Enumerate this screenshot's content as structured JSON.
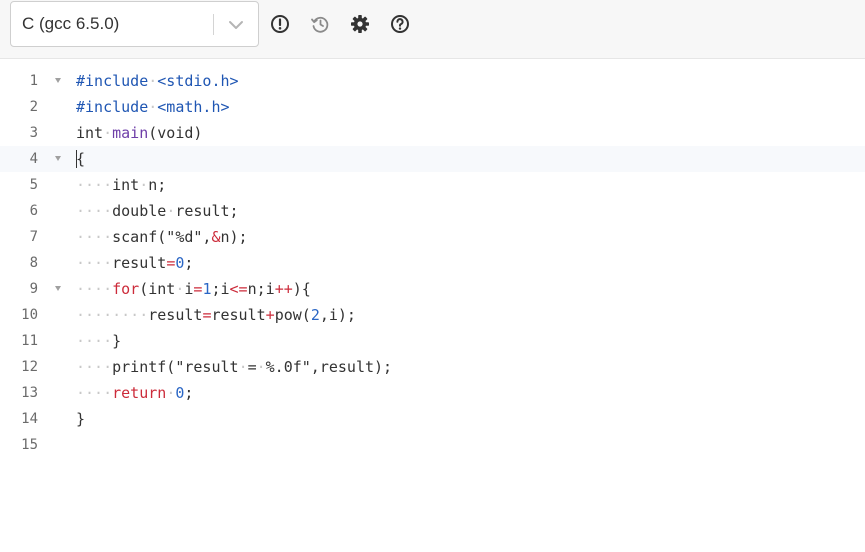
{
  "toolbar": {
    "language_value": "C (gcc 6.5.0)",
    "icons": [
      "info-icon",
      "history-icon",
      "gear-icon",
      "help-icon"
    ]
  },
  "editor": {
    "active_line": 4,
    "colors": {
      "default": "#333333",
      "preproc": "#1f56b3",
      "keyword": "#cc2b3a",
      "number": "#2a66c5",
      "string": "#333333",
      "func": "#6e3ea8",
      "whitespace_dot": "#c8c8c8",
      "line_number": "#6b6b6b"
    },
    "lines": [
      {
        "number": "1",
        "fold": true,
        "tokens": [
          {
            "t": "#include",
            "c": "preproc"
          },
          {
            "t": " ",
            "c": "ws"
          },
          {
            "t": "<stdio.h>",
            "c": "preproc"
          }
        ]
      },
      {
        "number": "2",
        "fold": false,
        "tokens": [
          {
            "t": "#include",
            "c": "preproc"
          },
          {
            "t": " ",
            "c": "ws"
          },
          {
            "t": "<math.h>",
            "c": "preproc"
          }
        ]
      },
      {
        "number": "3",
        "fold": false,
        "tokens": [
          {
            "t": "int",
            "c": "default"
          },
          {
            "t": " ",
            "c": "ws"
          },
          {
            "t": "main",
            "c": "func"
          },
          {
            "t": "(void)",
            "c": "default"
          }
        ]
      },
      {
        "number": "4",
        "fold": true,
        "tokens": [
          {
            "t": "{",
            "c": "default"
          }
        ]
      },
      {
        "number": "5",
        "fold": false,
        "tokens": [
          {
            "t": "    ",
            "c": "ws"
          },
          {
            "t": "int",
            "c": "default"
          },
          {
            "t": " ",
            "c": "ws"
          },
          {
            "t": "n;",
            "c": "default"
          }
        ]
      },
      {
        "number": "6",
        "fold": false,
        "tokens": [
          {
            "t": "    ",
            "c": "ws"
          },
          {
            "t": "double",
            "c": "default"
          },
          {
            "t": " ",
            "c": "ws"
          },
          {
            "t": "result;",
            "c": "default"
          }
        ]
      },
      {
        "number": "7",
        "fold": false,
        "tokens": [
          {
            "t": "    ",
            "c": "ws"
          },
          {
            "t": "scanf(\"%d\",",
            "c": "default"
          },
          {
            "t": "&",
            "c": "keyword"
          },
          {
            "t": "n);",
            "c": "default"
          }
        ]
      },
      {
        "number": "8",
        "fold": false,
        "tokens": [
          {
            "t": "    ",
            "c": "ws"
          },
          {
            "t": "result",
            "c": "default"
          },
          {
            "t": "=",
            "c": "keyword"
          },
          {
            "t": "0",
            "c": "number"
          },
          {
            "t": ";",
            "c": "default"
          }
        ]
      },
      {
        "number": "9",
        "fold": true,
        "tokens": [
          {
            "t": "    ",
            "c": "ws"
          },
          {
            "t": "for",
            "c": "keyword"
          },
          {
            "t": "(int",
            "c": "default"
          },
          {
            "t": " ",
            "c": "ws"
          },
          {
            "t": "i",
            "c": "default"
          },
          {
            "t": "=",
            "c": "keyword"
          },
          {
            "t": "1",
            "c": "number"
          },
          {
            "t": ";i",
            "c": "default"
          },
          {
            "t": "<=",
            "c": "keyword"
          },
          {
            "t": "n;i",
            "c": "default"
          },
          {
            "t": "++",
            "c": "keyword"
          },
          {
            "t": "){",
            "c": "default"
          }
        ]
      },
      {
        "number": "10",
        "fold": false,
        "tokens": [
          {
            "t": "        ",
            "c": "ws"
          },
          {
            "t": "result",
            "c": "default"
          },
          {
            "t": "=",
            "c": "keyword"
          },
          {
            "t": "result",
            "c": "default"
          },
          {
            "t": "+",
            "c": "keyword"
          },
          {
            "t": "pow(",
            "c": "default"
          },
          {
            "t": "2",
            "c": "number"
          },
          {
            "t": ",i);",
            "c": "default"
          }
        ]
      },
      {
        "number": "11",
        "fold": false,
        "tokens": [
          {
            "t": "    ",
            "c": "ws"
          },
          {
            "t": "}",
            "c": "default"
          }
        ]
      },
      {
        "number": "12",
        "fold": false,
        "tokens": [
          {
            "t": "    ",
            "c": "ws"
          },
          {
            "t": "printf(\"result",
            "c": "default"
          },
          {
            "t": " ",
            "c": "ws"
          },
          {
            "t": "=",
            "c": "default"
          },
          {
            "t": " ",
            "c": "ws"
          },
          {
            "t": "%.0f\",result);",
            "c": "default"
          }
        ]
      },
      {
        "number": "13",
        "fold": false,
        "tokens": [
          {
            "t": "    ",
            "c": "ws"
          },
          {
            "t": "return",
            "c": "keyword"
          },
          {
            "t": " ",
            "c": "ws"
          },
          {
            "t": "0",
            "c": "number"
          },
          {
            "t": ";",
            "c": "default"
          }
        ]
      },
      {
        "number": "14",
        "fold": false,
        "tokens": [
          {
            "t": "}",
            "c": "default"
          }
        ]
      },
      {
        "number": "15",
        "fold": false,
        "tokens": []
      }
    ]
  }
}
